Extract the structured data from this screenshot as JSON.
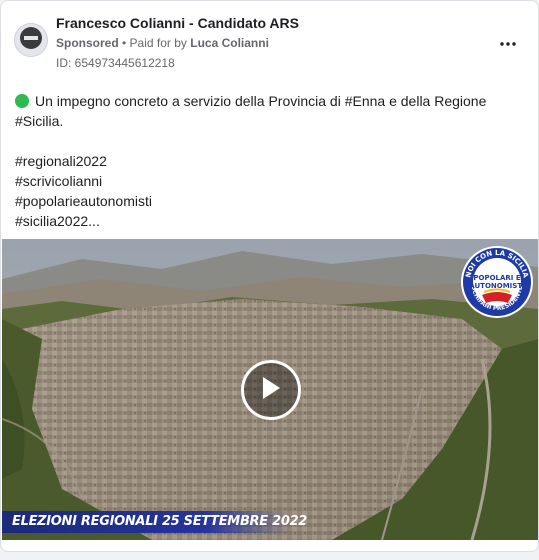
{
  "post": {
    "page_name": "Francesco Colianni - Candidato ARS",
    "sponsored_label": "Sponsored",
    "separator": " • ",
    "paid_for_prefix": "Paid for by ",
    "payer": "Luca Colianni",
    "ad_id": "ID: 654973445612218",
    "avatar_icon": "no-entry-icon",
    "more_icon": "more-dots-icon"
  },
  "text": {
    "line1": "Un impegno concreto a servizio della Provincia di #Enna e della Regione #Sicilia.",
    "hashtags": [
      "#regionali2022",
      "#scrivicolianni",
      "#popolarieautonomisti",
      "#sicilia2022..."
    ]
  },
  "media": {
    "play_icon": "play-icon",
    "banner": "ELEZIONI REGIONALI 25 SETTEMBRE 2022",
    "logo": {
      "top_arc": "NOI CON LA SICILIA",
      "line1": "POPOLARI E",
      "line2": "AUTONOMISTI",
      "bottom_arc": "SCHIFANI PRESIDENTE"
    }
  },
  "colors": {
    "green_dot": "#2dba4e",
    "banner_blue": "#1b2a7a",
    "logo_blue": "#1d3aa6",
    "logo_red": "#d62027",
    "logo_yellow": "#f4c20d"
  }
}
